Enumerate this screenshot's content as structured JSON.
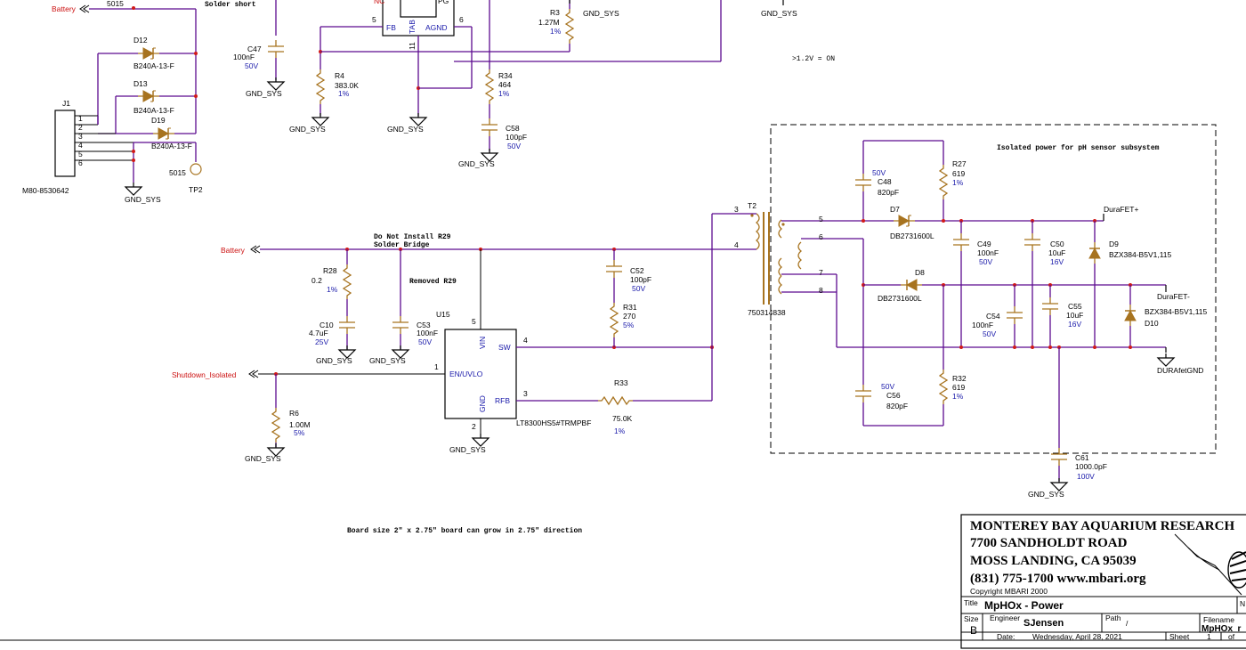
{
  "nets": {
    "battery": "Battery",
    "gnd_sys": "GND_SYS",
    "shutdown_isolated": "Shutdown_Isolated",
    "durafet_pos": "DuraFET+",
    "durafet_neg": "DuraFET-",
    "durafet_gnd": "DURAfetGND",
    "test_point_net": "5015"
  },
  "notes": {
    "solder_short": "Solder short",
    "threshold": ">1.2V = ON",
    "isolated_box": "Isolated power for pH sensor subsystem",
    "dni_r29_line1": "Do Not Install R29",
    "dni_r29_line2": "Solder Bridge",
    "removed_r29": "Removed R29",
    "board_size": "Board size 2\" x 2.75\"  board can grow in 2.75\" direction"
  },
  "connector": {
    "ref": "J1",
    "part": "M80-8530642",
    "pins": [
      "1",
      "2",
      "3",
      "4",
      "5",
      "6"
    ],
    "tp_ref": "TP2"
  },
  "components": {
    "D12": {
      "ref": "D12",
      "part": "B240A-13-F"
    },
    "D13": {
      "ref": "D13",
      "part": "B240A-13-F"
    },
    "D19": {
      "ref": "D19",
      "part": "B240A-13-F"
    },
    "C47": {
      "ref": "C47",
      "value": "100nF",
      "rating": "50V"
    },
    "R4": {
      "ref": "R4",
      "value": "383.0K",
      "tol": "1%"
    },
    "R3": {
      "ref": "R3",
      "value": "1.27M",
      "tol": "1%"
    },
    "R34": {
      "ref": "R34",
      "value": "464",
      "tol": "1%"
    },
    "C58": {
      "ref": "C58",
      "value": "100pF",
      "rating": "50V"
    },
    "R28": {
      "ref": "R28",
      "value": "0.2",
      "tol": "1%"
    },
    "C10": {
      "ref": "C10",
      "value": "4.7uF",
      "rating": "25V"
    },
    "C53": {
      "ref": "C53",
      "value": "100nF",
      "rating": "50V"
    },
    "R6": {
      "ref": "R6",
      "value": "1.00M",
      "tol": "5%"
    },
    "C52": {
      "ref": "C52",
      "value": "100pF",
      "rating": "50V"
    },
    "R31": {
      "ref": "R31",
      "value": "270",
      "tol": "5%"
    },
    "R33": {
      "ref": "R33",
      "value": "75.0K",
      "tol": "1%"
    },
    "T2": {
      "ref": "T2",
      "part": "750314838"
    },
    "C48": {
      "ref": "C48",
      "value": "820pF",
      "rating": "50V"
    },
    "R27": {
      "ref": "R27",
      "value": "619",
      "tol": "1%"
    },
    "D7": {
      "ref": "D7",
      "part": "DB2731600L"
    },
    "D8": {
      "ref": "D8",
      "part": "DB2731600L"
    },
    "C49": {
      "ref": "C49",
      "value": "100nF",
      "rating": "50V"
    },
    "C50": {
      "ref": "C50",
      "value": "10uF",
      "rating": "16V"
    },
    "D9": {
      "ref": "D9",
      "part": "BZX384-B5V1,115"
    },
    "D10": {
      "ref": "D10",
      "part": "BZX384-B5V1,115"
    },
    "C54": {
      "ref": "C54",
      "value": "100nF",
      "rating": "50V"
    },
    "C55": {
      "ref": "C55",
      "value": "10uF",
      "rating": "16V"
    },
    "C56": {
      "ref": "C56",
      "value": "820pF",
      "rating": "50V"
    },
    "R32": {
      "ref": "R32",
      "value": "619",
      "tol": "1%"
    },
    "C61": {
      "ref": "C61",
      "value": "1000.0pF",
      "rating": "100V"
    }
  },
  "upper_ic": {
    "pin_nc": "NC",
    "pin_pg": "PG",
    "pin_fb": "FB",
    "pin_tab": "TAB",
    "pin_agnd": "AGND",
    "pin5": "5",
    "pin6": "6",
    "pin11": "11"
  },
  "u15": {
    "ref": "U15",
    "part": "LT8300HS5#TRMPBF",
    "pins": {
      "vin": "VIN",
      "sw": "SW",
      "en": "EN/UVLO",
      "rfb": "RFB",
      "gnd": "GND",
      "n5": "5",
      "n4": "4",
      "n1": "1",
      "n3": "3",
      "n2": "2"
    }
  },
  "t2_pins": [
    "3",
    "4",
    "5",
    "6",
    "7",
    "8"
  ],
  "title_block": {
    "org": "MONTEREY BAY AQUARIUM RESEARCH",
    "address": "7700 SANDHOLDT ROAD",
    "city": "MOSS LANDING, CA 95039",
    "contact": "(831) 775-1700  www.mbari.org",
    "copyright": "Copyright MBARI 2000",
    "title_label": "Title",
    "title_value": "MpHOx - Power",
    "n_label": "N",
    "size_label": "Size",
    "size_value": "B",
    "engineer_label": "Engineer",
    "engineer_value": "SJensen",
    "path_label": "Path",
    "path_value": "/",
    "filename_label": "Filename",
    "filename_value": "MpHOx_r",
    "date_label": "Date:",
    "date_value": "Wednesday, April 28, 2021",
    "sheet_label": "Sheet",
    "sheet_value": "1",
    "of_label": "of"
  },
  "colors": {
    "wire": "#5c0b8f",
    "component": "#a7731f",
    "value_text": "#1a1aaa",
    "net_label": "#cc1111",
    "junction": "#d11919"
  }
}
